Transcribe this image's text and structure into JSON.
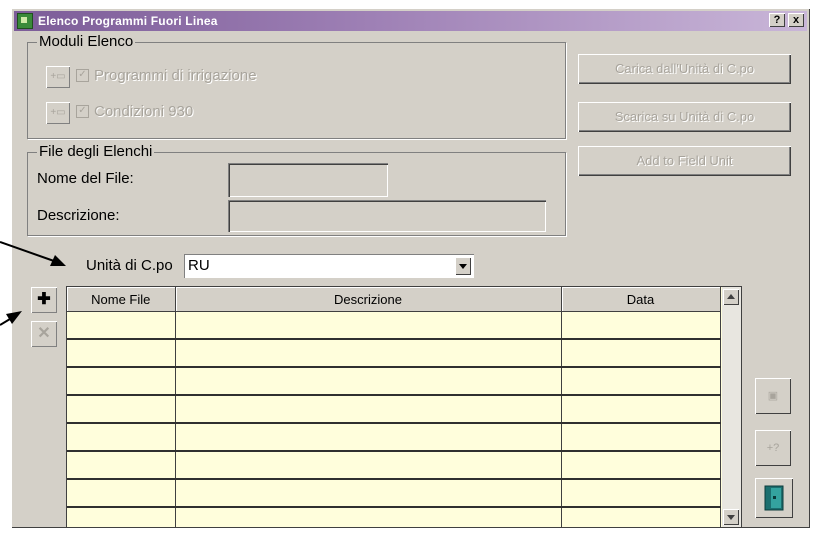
{
  "window": {
    "title": "Elenco Programmi Fuori Linea",
    "help_button": "?",
    "close_button": "x"
  },
  "moduli": {
    "legend": "Moduli Elenco",
    "items": [
      {
        "label": "Programmi di irrigazione",
        "checked": true,
        "enabled": false
      },
      {
        "label": "Condizioni 930",
        "checked": true,
        "enabled": false
      }
    ]
  },
  "file_group": {
    "legend": "File degli Elenchi",
    "name_label": "Nome del File:",
    "name_value": "",
    "description_label": "Descrizione:",
    "description_value": ""
  },
  "right_buttons": {
    "load": "Carica dall'Unità di C.po",
    "download": "Scarica su Unità di C.po",
    "add_field": "Add to Field Unit"
  },
  "unit": {
    "label": "Unità di C.po",
    "selected": "RU"
  },
  "table": {
    "columns": [
      "Nome File",
      "Descrizione",
      "Data"
    ],
    "rows": [
      [
        "",
        "",
        ""
      ],
      [
        "",
        "",
        ""
      ],
      [
        "",
        "",
        ""
      ],
      [
        "",
        "",
        ""
      ],
      [
        "",
        "",
        ""
      ],
      [
        "",
        "",
        ""
      ],
      [
        "",
        "",
        ""
      ],
      [
        "",
        "",
        ""
      ]
    ]
  },
  "icons": {
    "add": "plus-icon",
    "delete": "x-icon",
    "save": "floppy-disk-icon",
    "help": "question-icon",
    "exit": "exit-door-icon"
  },
  "colors": {
    "titlebar": "#7c5c98",
    "grid_background": "#fffedc",
    "window_face": "#d4d0c8"
  }
}
